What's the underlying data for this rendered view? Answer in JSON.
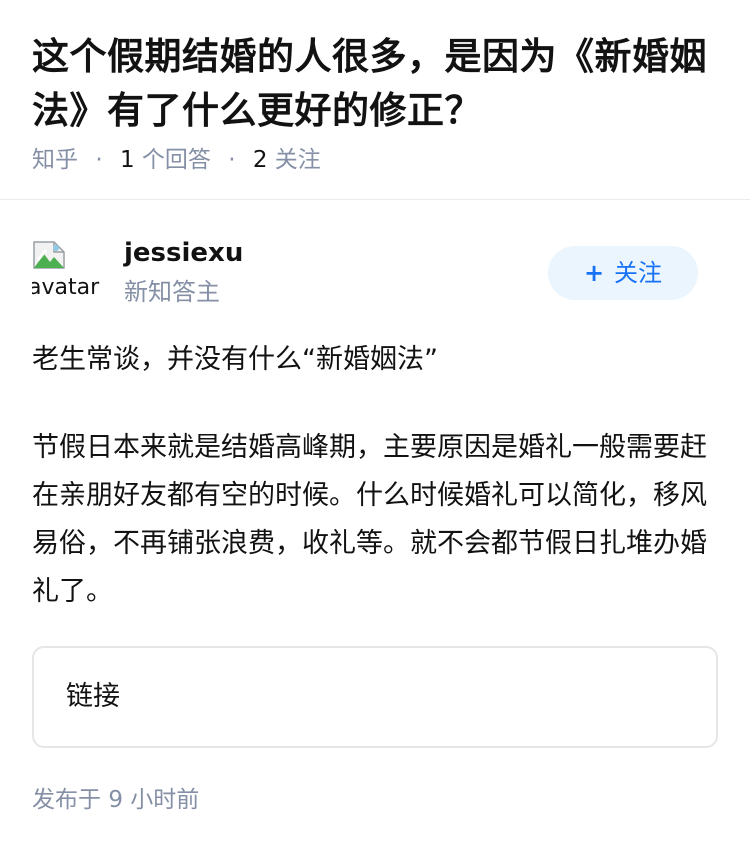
{
  "question": {
    "title": "这个假期结婚的人很多，是因为《新婚姻法》有了什么更好的修正？",
    "meta": {
      "source": "知乎",
      "separator": "·",
      "answer_count": "1",
      "answer_label": "个回答",
      "follow_count": "2",
      "follow_label": "关注"
    }
  },
  "author": {
    "avatar_alt": "avatar",
    "avatar_icon": "broken-image-icon",
    "name": "jessiexu",
    "badge": "新知答主",
    "follow_button": {
      "plus": "+",
      "label": "关注"
    }
  },
  "answer": {
    "paragraphs": [
      "老生常谈，并没有什么“新婚姻法”",
      "节假日本来就是结婚高峰期，主要原因是婚礼一般需要赶在亲朋好友都有空的时候。什么时候婚礼可以简化，移风易俗，不再铺张浪费，收礼等。就不会都节假日扎堆办婚礼了。"
    ],
    "link_card_label": "链接",
    "published_prefix": "发布于",
    "published_time": "9 小时前"
  },
  "colors": {
    "accent": "#1772f6",
    "accent_bg": "#ebf5fd",
    "muted": "#8590a6",
    "text": "#121212"
  }
}
